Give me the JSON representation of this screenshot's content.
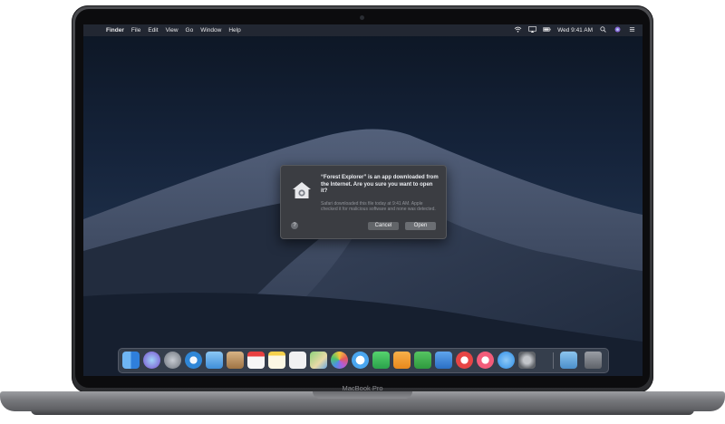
{
  "menubar": {
    "apple_glyph": "",
    "items": [
      "Finder",
      "File",
      "Edit",
      "View",
      "Go",
      "Window",
      "Help"
    ],
    "clock": "Wed 9:41 AM"
  },
  "dialog": {
    "title": "“Forest Explorer” is an app downloaded from the Internet. Are you sure you want to open it?",
    "body": "Safari downloaded this file today at 9:41 AM. Apple checked it for malicious software and none was detected.",
    "help_label": "?",
    "cancel_label": "Cancel",
    "open_label": "Open"
  },
  "dock": {
    "icons": [
      {
        "name": "finder-icon",
        "color": "#3d8be6"
      },
      {
        "name": "siri-icon",
        "color": "#8a5bd8"
      },
      {
        "name": "launchpad-icon",
        "color": "#7a7f88"
      },
      {
        "name": "safari-icon",
        "color": "#2f86d6"
      },
      {
        "name": "mail-icon",
        "color": "#4a9de8"
      },
      {
        "name": "contacts-icon",
        "color": "#b58a57"
      },
      {
        "name": "calendar-icon",
        "color": "#f2f2f2"
      },
      {
        "name": "notes-icon",
        "color": "#f2d34a"
      },
      {
        "name": "reminders-icon",
        "color": "#e9e9ea"
      },
      {
        "name": "maps-icon",
        "color": "#6bbf5e"
      },
      {
        "name": "photos-icon",
        "color": "#f0a63a"
      },
      {
        "name": "messages-icon",
        "color": "#4aa6ef"
      },
      {
        "name": "facetime-icon",
        "color": "#3dbb5a"
      },
      {
        "name": "pages-icon",
        "color": "#f19a2e"
      },
      {
        "name": "numbers-icon",
        "color": "#3aa748"
      },
      {
        "name": "keynote-icon",
        "color": "#3a86d8"
      },
      {
        "name": "news-icon",
        "color": "#e64545"
      },
      {
        "name": "music-icon",
        "color": "#f35c7a"
      },
      {
        "name": "app-store-icon",
        "color": "#2d8de6"
      },
      {
        "name": "system-preferences-icon",
        "color": "#8a8d93"
      },
      {
        "name": "downloads-folder-icon",
        "color": "#5aa0d8"
      },
      {
        "name": "trash-icon",
        "color": "#6d7178"
      }
    ]
  },
  "brand": "MacBook Pro"
}
